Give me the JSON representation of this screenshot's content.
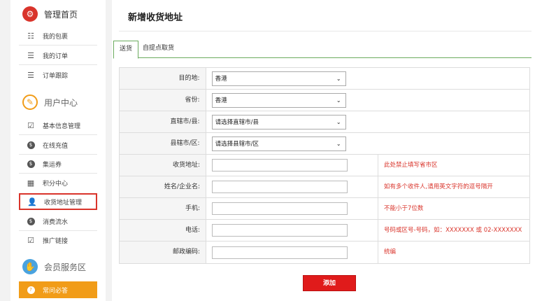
{
  "sidebar": {
    "sections": [
      {
        "title": "管理首页",
        "icon": "gear-icon",
        "color": "#d9342b"
      },
      {
        "title": "用户中心",
        "icon": "pencil-icon",
        "color": "#f19c18"
      },
      {
        "title": "会员服务区",
        "icon": "handshake-icon",
        "color": "#4aa3df"
      }
    ],
    "items": [
      {
        "label": "我的包裹",
        "icon": "list-grid-icon"
      },
      {
        "label": "我的订单",
        "icon": "list-icon"
      },
      {
        "label": "订单跟踪",
        "icon": "list-icon"
      },
      {
        "label": "基本信息管理",
        "icon": "edit-icon"
      },
      {
        "label": "在线充值",
        "icon": "coin-icon"
      },
      {
        "label": "集运券",
        "icon": "coin-icon"
      },
      {
        "label": "积分中心",
        "icon": "building-icon"
      },
      {
        "label": "收货地址管理",
        "icon": "user-icon"
      },
      {
        "label": "消费流水",
        "icon": "coin-icon"
      },
      {
        "label": "推广链接",
        "icon": "check-box-icon"
      },
      {
        "label": "常问必答",
        "icon": "question-icon"
      }
    ]
  },
  "main": {
    "title": "新增收货地址",
    "tabs": [
      "送货",
      "自提点取货"
    ],
    "form": {
      "destination": {
        "label": "目的地:",
        "value": "香港"
      },
      "province": {
        "label": "省份:",
        "value": "香港"
      },
      "city": {
        "label": "直辖市/县:",
        "value": "请选择直辖市/县"
      },
      "district": {
        "label": "县辖市/区:",
        "value": "请选择县辖市/区"
      },
      "address": {
        "label": "收货地址:",
        "hint": "此处禁止填写省市区"
      },
      "name": {
        "label": "姓名/企业名:",
        "hint": "如有多个收件人,请用英文字符的逗号隔开"
      },
      "mobile": {
        "label": "手机:",
        "hint": "不能小于7位数"
      },
      "phone": {
        "label": "电话:",
        "hint": "号码或区号-号码，如：XXXXXXX 或 02-XXXXXXX"
      },
      "postcode": {
        "label": "邮政编码:",
        "hint": "统编"
      }
    },
    "submit_label": "添加"
  },
  "colors": {
    "accent": "#d9342b",
    "tab_border": "#6bab5e",
    "help_bg": "#f19c18",
    "button": "#e01b1b"
  }
}
